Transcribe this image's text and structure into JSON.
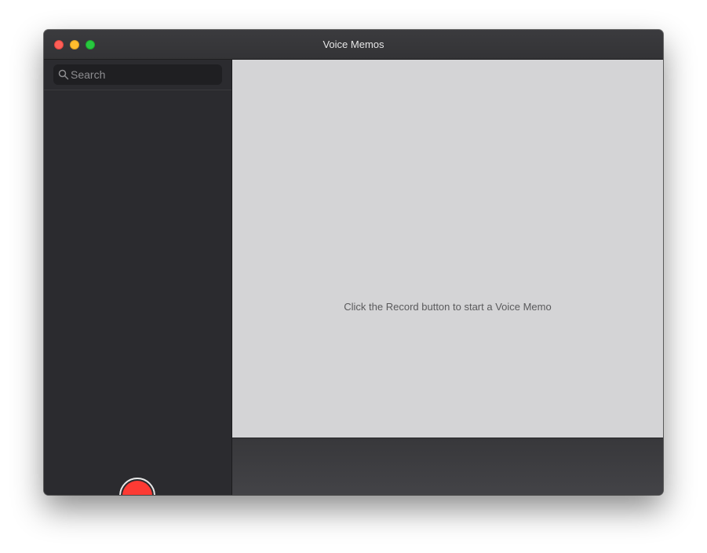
{
  "window": {
    "title": "Voice Memos"
  },
  "sidebar": {
    "search": {
      "placeholder": "Search",
      "value": ""
    },
    "record_button_icon": "record-icon"
  },
  "main": {
    "empty_message": "Click the Record button to start a Voice Memo"
  },
  "colors": {
    "record_red": "#fd3a34",
    "close": "#fe5f57",
    "minimize": "#febc2e",
    "zoom": "#28c840"
  }
}
